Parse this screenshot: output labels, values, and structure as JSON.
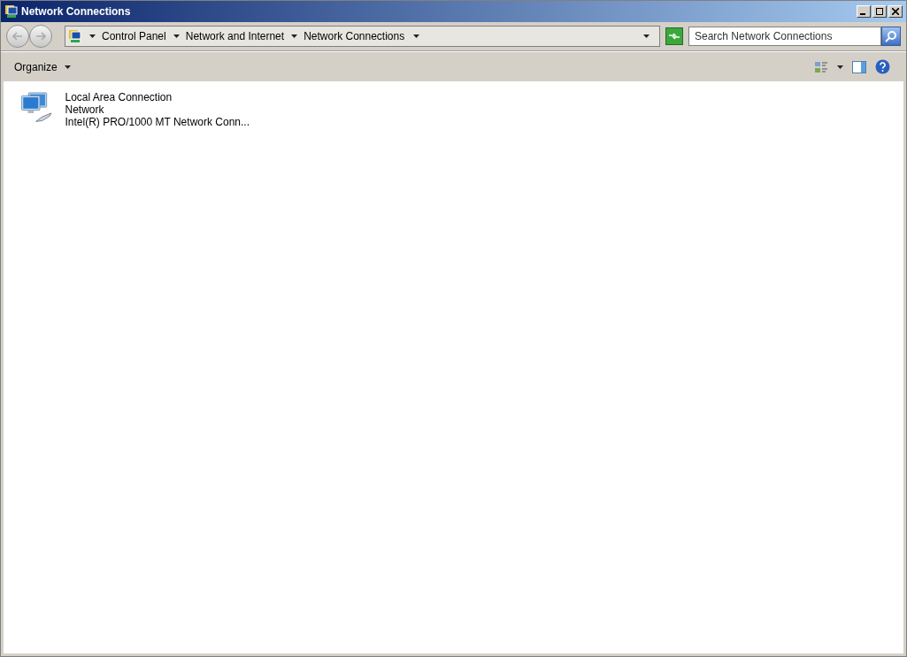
{
  "window": {
    "title": "Network Connections"
  },
  "address": {
    "breadcrumbs": [
      "Control Panel",
      "Network and Internet",
      "Network Connections"
    ]
  },
  "search": {
    "placeholder": "Search Network Connections"
  },
  "toolbar": {
    "organize": "Organize"
  },
  "connections": [
    {
      "name": "Local Area Connection",
      "status": "Network",
      "device": "Intel(R) PRO/1000 MT Network Conn..."
    }
  ]
}
